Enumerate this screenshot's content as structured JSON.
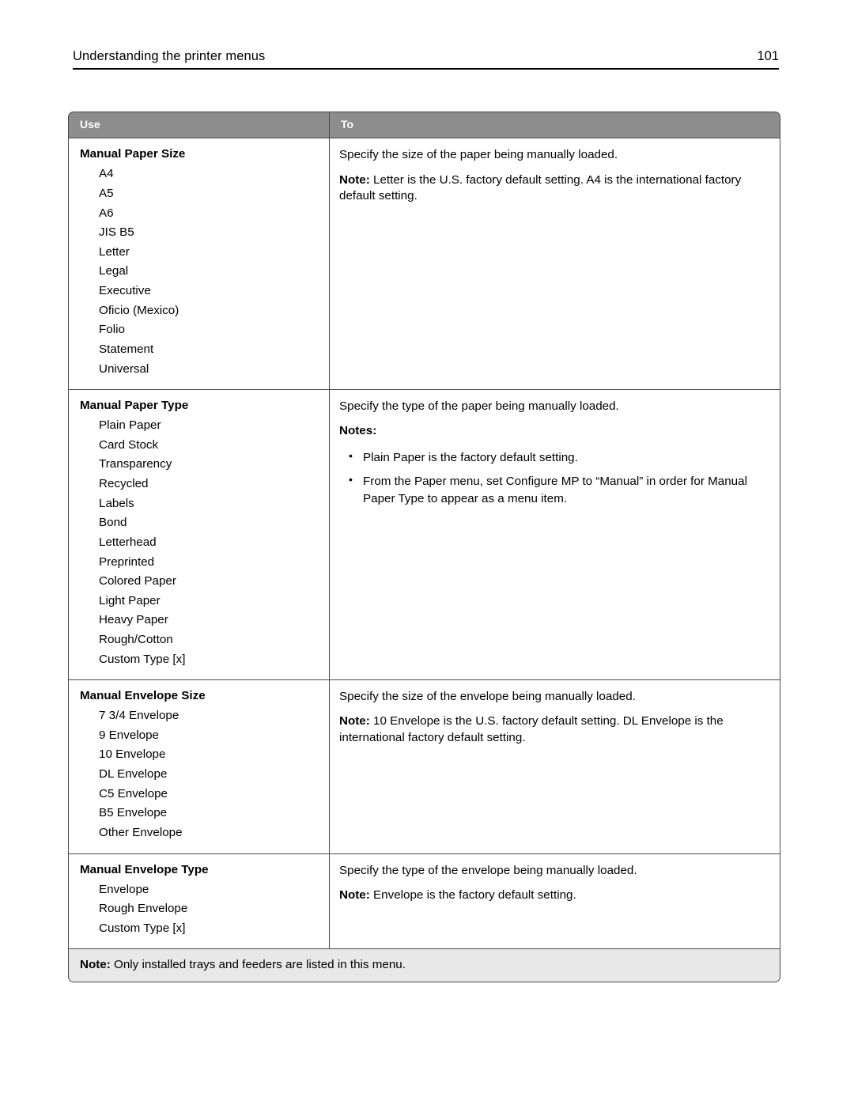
{
  "header": {
    "title": "Understanding the printer menus",
    "page_number": "101"
  },
  "table": {
    "columns": {
      "use": "Use",
      "to": "To"
    },
    "rows": [
      {
        "setting": "Manual Paper Size",
        "options": [
          "A4",
          "A5",
          "A6",
          "JIS B5",
          "Letter",
          "Legal",
          "Executive",
          "Oficio (Mexico)",
          "Folio",
          "Statement",
          "Universal"
        ],
        "description": "Specify the size of the paper being manually loaded.",
        "note_label": "Note:",
        "note_text": " Letter is the U.S. factory default setting. A4 is the international factory default setting."
      },
      {
        "setting": "Manual Paper Type",
        "options": [
          "Plain Paper",
          "Card Stock",
          "Transparency",
          "Recycled",
          "Labels",
          "Bond",
          "Letterhead",
          "Preprinted",
          "Colored Paper",
          "Light Paper",
          "Heavy Paper",
          "Rough/Cotton",
          "Custom Type [x]"
        ],
        "description": "Specify the type of the paper being manually loaded.",
        "notes_label": "Notes:",
        "notes": [
          "Plain Paper is the factory default setting.",
          "From the Paper menu, set Configure MP to “Manual” in order for Manual Paper Type to appear as a menu item."
        ]
      },
      {
        "setting": "Manual Envelope Size",
        "options": [
          "7 3/4 Envelope",
          "9 Envelope",
          "10 Envelope",
          "DL Envelope",
          "C5 Envelope",
          "B5 Envelope",
          "Other Envelope"
        ],
        "description": "Specify the size of the envelope being manually loaded.",
        "note_label": "Note:",
        "note_text": " 10 Envelope is the U.S. factory default setting. DL Envelope is the international factory default setting."
      },
      {
        "setting": "Manual Envelope Type",
        "options": [
          "Envelope",
          "Rough Envelope",
          "Custom Type [x]"
        ],
        "description": "Specify the type of the envelope being manually loaded.",
        "note_label": "Note:",
        "note_text": " Envelope is the factory default setting."
      }
    ],
    "footnote": {
      "label": "Note:",
      "text": " Only installed trays and feeders are listed in this menu."
    }
  }
}
